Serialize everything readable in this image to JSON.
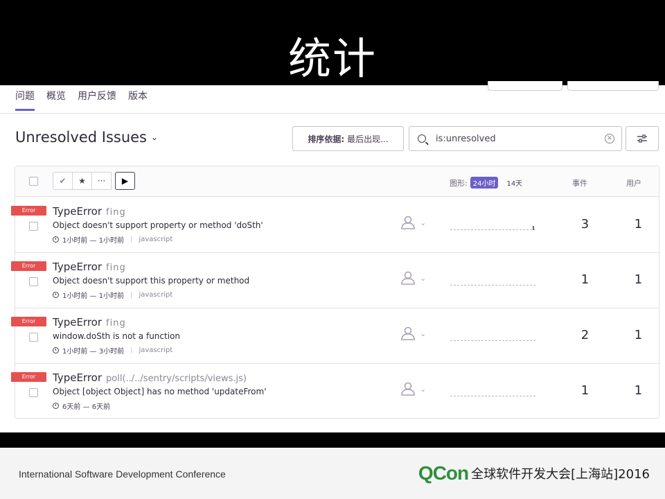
{
  "slide": {
    "title": "统计",
    "footer_left": "International Software Development Conference",
    "footer_logo": "QCon",
    "footer_right": "全球软件开发大会[上海站]2016"
  },
  "tabs": [
    {
      "label": "问题",
      "active": true
    },
    {
      "label": "概览",
      "active": false
    },
    {
      "label": "用户反馈",
      "active": false
    },
    {
      "label": "版本",
      "active": false
    }
  ],
  "heading": "Unresolved Issues",
  "sort": {
    "label": "排序依据:",
    "value": "最后出现..."
  },
  "search": {
    "value": "is:unresolved"
  },
  "table_header": {
    "graph_label": "图形:",
    "range_active": "24小时",
    "range_other": "14天",
    "col_events": "事件",
    "col_users": "用户"
  },
  "issues": [
    {
      "level": "Error",
      "type": "TypeError",
      "culprit": "fing",
      "message": "Object doesn't support property or method 'doSth'",
      "time": "1小时前 — 1小时前",
      "platform": "javascript",
      "events": "3",
      "users": "1",
      "spark": [
        0,
        0,
        0,
        0,
        0,
        0,
        0,
        0,
        0,
        0,
        0,
        0,
        0,
        0,
        0,
        0,
        0,
        0,
        0,
        0,
        0,
        0,
        0,
        0,
        0,
        0,
        0,
        0,
        0,
        0,
        0,
        0,
        0,
        0,
        0,
        0,
        0,
        0,
        0,
        0,
        0,
        0,
        0,
        0,
        0,
        0,
        0,
        0,
        0,
        0,
        0,
        0,
        0,
        0,
        0,
        0,
        0,
        0,
        1,
        0
      ]
    },
    {
      "level": "Error",
      "type": "TypeError",
      "culprit": "fing",
      "message": "Object doesn't support this property or method",
      "time": "1小时前 — 1小时前",
      "platform": "javascript",
      "events": "1",
      "users": "1",
      "spark": []
    },
    {
      "level": "Error",
      "type": "TypeError",
      "culprit": "fing",
      "message": "window.doSth is not a function",
      "time": "1小时前 — 3小时前",
      "platform": "javascript",
      "events": "2",
      "users": "1",
      "spark": []
    },
    {
      "level": "Error",
      "type": "TypeError",
      "culprit": "poll(../../sentry/scripts/views.js)",
      "message": "Object [object Object] has no method 'updateFrom'",
      "time": "6天前 — 6天前",
      "platform": "",
      "events": "1",
      "users": "1",
      "spark": []
    }
  ]
}
